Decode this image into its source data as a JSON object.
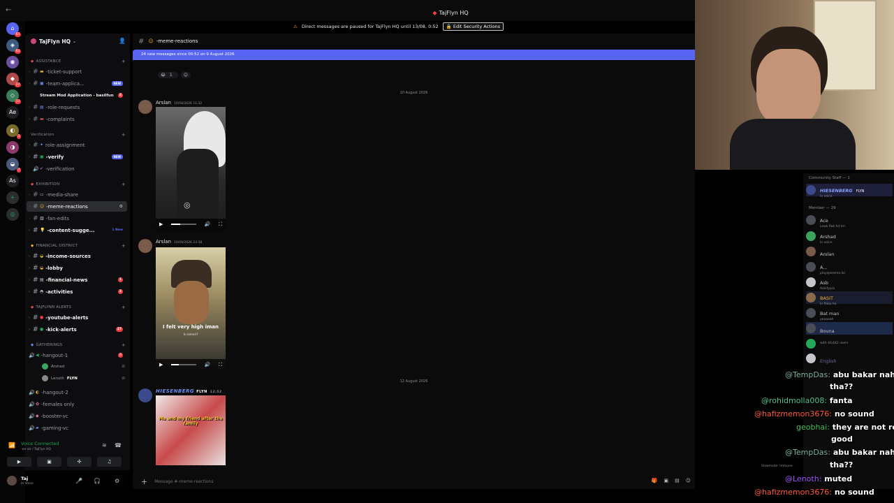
{
  "window": {
    "title": "TajFlyn HQ",
    "back_glyph": "←",
    "title_icon": "◆"
  },
  "banner": {
    "icon": "⚠",
    "text": "Direct messages are paused for TajFlyn HQ until 13/08, 0:52",
    "button": "Edit Security Actions",
    "button_icon": "🔒"
  },
  "rail": {
    "home_glyph": "⊕",
    "add_glyph": "+",
    "discover_glyph": "◎",
    "ae": "Ae",
    "as": "As",
    "pings": [
      "67",
      "61",
      "27",
      "17",
      "3",
      "7"
    ]
  },
  "guild": {
    "name": "TajFlyn HQ",
    "caret": "⌄",
    "invite_icon": "👤"
  },
  "categories": {
    "assistance": "ASSISTANCE",
    "verification": "Verification",
    "exhibition": "EXHIBITION",
    "financial": "FINANCIAL DISTRICT",
    "alerts": "TAJFLYNN ALERTS",
    "gatherings": "GATHERINGS"
  },
  "channels": {
    "ticket_support": "-ticket-support",
    "team_applications": "-team-applica...",
    "stream_mod": "Stream Mod Application - basilfun",
    "role_requests": "-role-requests",
    "complaints": "-complaints",
    "role_assignment": "role-assignment",
    "verify": "-verify",
    "verification": "-verification",
    "media_share": "-media-share",
    "memes": "-meme-reactions",
    "fan_edits": "-fan-edits",
    "content_suggestions": "-content-sugge...",
    "income_sources": "-income-sources",
    "lobby": "-lobby",
    "financial_news": "-financial-news",
    "activities": "-activities",
    "youtube_alerts": "-youtube-alerts",
    "kick_alerts": "-kick-alerts",
    "hangout_1": "-hangout-1",
    "hangout_2": "-hangout-2",
    "females_only": "-females only",
    "booster_vc": "-booster-vc",
    "gaming_vc": "-gaming-vc"
  },
  "badges": {
    "stream_mod": "2",
    "new": "NEW",
    "content_new": "1 New",
    "financial_news": "1",
    "activities": "2",
    "kick_alerts": "17",
    "hangout_1": "8"
  },
  "voice_users": {
    "u1": "Arshad",
    "u2": "Lenoth",
    "u2_tag": "FLYN"
  },
  "voice": {
    "status": "Voice Connected",
    "channel": "-on-air / TajFlyn HQ",
    "signal_icon": "📶"
  },
  "user": {
    "name": "Taj",
    "status": "In Voice"
  },
  "chat": {
    "channel": "-meme-reactions",
    "new_messages": "24 new messages since 00:52 on 9 August 2026",
    "react_count": "1",
    "date1": "10 August 2026",
    "date2": "12 August 2026",
    "composer_placeholder": "Message #-meme-reactions"
  },
  "messages": [
    {
      "author": "Arslan",
      "time": "10/08/2026 11:32"
    },
    {
      "author": "Arslan",
      "time": "10/08/2026 23:38",
      "caption": "I felt very high iman",
      "subcaption": "Is correct?"
    },
    {
      "author": "HIESENBERG",
      "tag": "FLYN",
      "time": "12:52",
      "caption": "Me and my friend after the family"
    }
  ],
  "video_progress": [
    0.35,
    0.3
  ],
  "members": {
    "staff_header": "Community Staff — 1",
    "member_header": "Member — 29",
    "list": [
      {
        "name": "HIESENBERG",
        "tag": "FLYN",
        "sub": "In voice"
      },
      {
        "name": "Ace",
        "sub": "Lowk flak hd trn"
      },
      {
        "name": "Arshad",
        "sub": "In voice"
      },
      {
        "name": "Arslan",
        "sub": ""
      },
      {
        "name": "A...",
        "sub": "playsperemo.lol"
      },
      {
        "name": "Asb",
        "sub": "Ashifyora"
      },
      {
        "name": "BASIT",
        "sub": "In flaka ho"
      },
      {
        "name": "Bat man",
        "sub": "yeaaaah"
      },
      {
        "name": "Bouna",
        "sub": ""
      },
      {
        "name": "",
        "sub": "with 40,642 users"
      },
      {
        "name": "English",
        "sub": ""
      }
    ]
  },
  "stream_chat": [
    {
      "user": "@TempDas:",
      "msg": "abu bakar nahi ke",
      "color": "#7fb3a8"
    },
    {
      "user": "",
      "msg": "tha??",
      "color": "#ffffff"
    },
    {
      "user": "@rohidmolla008:",
      "msg": "fanta",
      "color": "#4fc48a"
    },
    {
      "user": "@hafizmemon3676:",
      "msg": "no sound",
      "color": "#ff5a3d"
    },
    {
      "user": "geobhai:",
      "msg": "they are not real",
      "color": "#44c455"
    },
    {
      "user": "",
      "msg": "good",
      "color": "#ffffff"
    },
    {
      "user": "@TempDas:",
      "msg": "abu bakar nahi ke",
      "color": "#7fb3a8"
    },
    {
      "user": "",
      "msg": "tha??",
      "color": "#ffffff"
    },
    {
      "user": "@Lenoth:",
      "msg": "muted",
      "color": "#9b59ff"
    },
    {
      "user": "@hafizmemon3676:",
      "msg": "no sound",
      "color": "#ff5a3d"
    }
  ],
  "slowmode": "Slowmode: Immune"
}
